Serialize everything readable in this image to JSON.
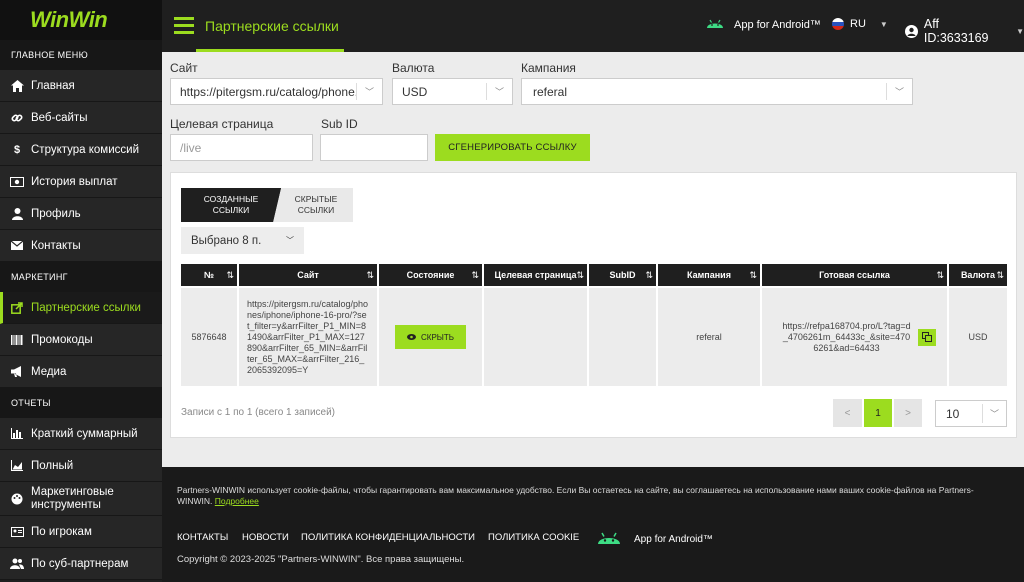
{
  "brand": {
    "logo": "WinWin",
    "accent": "#9cdc1f"
  },
  "sidebar": {
    "main_header": "ГЛАВНОЕ МЕНЮ",
    "main_items": [
      {
        "label": "Главная",
        "icon": "home-icon"
      },
      {
        "label": "Веб-сайты",
        "icon": "link-icon"
      },
      {
        "label": "Структура комиссий",
        "icon": "dollar-icon"
      },
      {
        "label": "История выплат",
        "icon": "money-icon"
      },
      {
        "label": "Профиль",
        "icon": "user-icon"
      },
      {
        "label": "Контакты",
        "icon": "envelope-icon"
      }
    ],
    "marketing_header": "МАРКЕТИНГ",
    "marketing_items": [
      {
        "label": "Партнерские ссылки",
        "icon": "external-link-icon",
        "active": true
      },
      {
        "label": "Промокоды",
        "icon": "barcode-icon"
      },
      {
        "label": "Медиа",
        "icon": "megaphone-icon"
      }
    ],
    "reports_header": "ОТЧЕТЫ",
    "reports_items": [
      {
        "label": "Краткий суммарный",
        "icon": "bar-chart-icon"
      },
      {
        "label": "Полный",
        "icon": "area-chart-icon"
      },
      {
        "label": "Маркетинговые инструменты",
        "icon": "palette-icon"
      },
      {
        "label": "По игрокам",
        "icon": "id-card-icon"
      },
      {
        "label": "По суб-партнерам",
        "icon": "users-icon"
      }
    ]
  },
  "topbar": {
    "title": "Партнерские ссылки",
    "android": "App for Android™",
    "lang": "RU",
    "user": "Aff ID:3633169"
  },
  "form": {
    "site_label": "Сайт",
    "site_value": "https://pitergsm.ru/catalog/phone...",
    "currency_label": "Валюта",
    "currency_value": "USD",
    "campaign_label": "Кампания",
    "campaign_value": "referal",
    "target_label": "Целевая страница",
    "target_placeholder": "/live",
    "subid_label": "Sub ID",
    "subid_value": "",
    "generate_button": "СГЕНЕРИРОВАТЬ ССЫЛКУ"
  },
  "tabs": {
    "created": "СОЗДАННЫЕ ССЫЛКИ",
    "hidden": "СКРЫТЫЕ ССЫЛКИ"
  },
  "column_select": "Выбрано 8 п.",
  "table": {
    "headers": [
      "№",
      "Сайт",
      "Состояние",
      "Целевая страница",
      "SubID",
      "Кампания",
      "Готовая ссылка",
      "Валюта"
    ],
    "row": {
      "id": "5876648",
      "site": "https://pitergsm.ru/catalog/phones/iphone/iphone-16-pro/?set_filter=y&arrFilter_P1_MIN=81490&arrFilter_P1_MAX=127890&arrFilter_65_MIN=&arrFilter_65_MAX=&arrFilter_216_2065392095=Y",
      "state_button": "СКРЫТЬ",
      "target": "",
      "subid": "",
      "campaign": "referal",
      "link": "https://refpa168704.pro/L?tag=d_4706261m_64433c_&site=4706261&ad=64433",
      "currency": "USD"
    }
  },
  "pagination": {
    "records": "Записи с 1 по 1 (всего 1 записей)",
    "prev": "<",
    "current": "1",
    "next": ">",
    "per_page": "10"
  },
  "footer": {
    "cookie_text": "Partners-WINWIN использует cookie-файлы, чтобы гарантировать вам максимальное удобство. Если Вы остаетесь на сайте, вы соглашаетесь на использование нами ваших cookie-файлов на Partners-WINWIN.",
    "more_link": "Подробнее",
    "nav": [
      "КОНТАКТЫ",
      "НОВОСТИ",
      "ПОЛИТИКА КОНФИДЕНЦИАЛЬНОСТИ",
      "ПОЛИТИКА COOKIE"
    ],
    "android": "App for Android™",
    "copyright": "Copyright © 2023-2025 \"Partners-WINWIN\". Все права защищены."
  }
}
